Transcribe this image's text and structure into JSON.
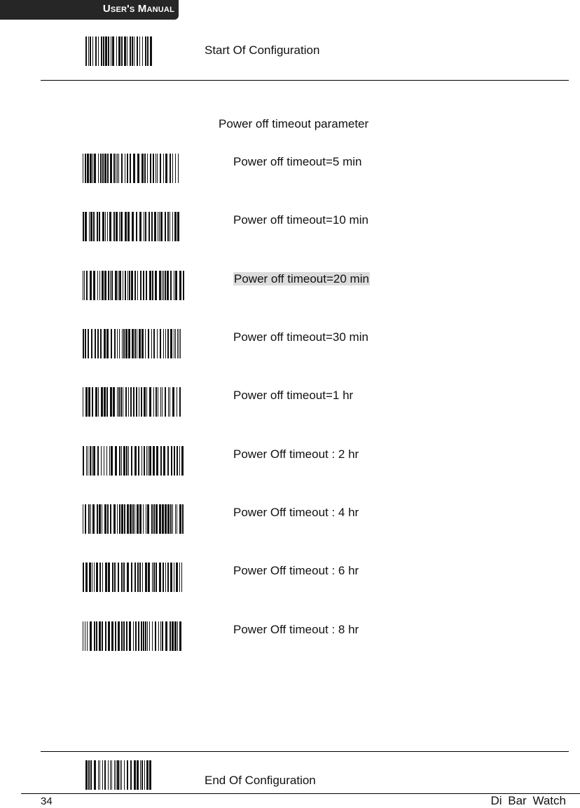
{
  "header": {
    "title": "User's Manual"
  },
  "start": {
    "label": "Start Of Configuration",
    "barcode_icon": "barcode-icon"
  },
  "section": {
    "title": "Power off timeout parameter",
    "options": [
      {
        "label": "Power off timeout=5 min",
        "highlighted": false
      },
      {
        "label": "Power off timeout=10 min",
        "highlighted": false
      },
      {
        "label": "Power off timeout=20 min",
        "highlighted": true
      },
      {
        "label": "Power off timeout=30 min",
        "highlighted": false
      },
      {
        "label": "Power off timeout=1 hr",
        "highlighted": false
      },
      {
        "label": "Power Off timeout : 2 hr",
        "highlighted": false
      },
      {
        "label": "Power Off timeout : 4 hr",
        "highlighted": false
      },
      {
        "label": "Power Off timeout : 6 hr",
        "highlighted": false
      },
      {
        "label": "Power Off timeout : 8 hr",
        "highlighted": false
      }
    ]
  },
  "end": {
    "label": "End Of Configuration",
    "barcode_icon": "barcode-icon"
  },
  "footer": {
    "page_number": "34",
    "brand": "Di Bar Watch"
  },
  "colors": {
    "header_bg": "#262626",
    "highlight": "#dcdcdc"
  }
}
